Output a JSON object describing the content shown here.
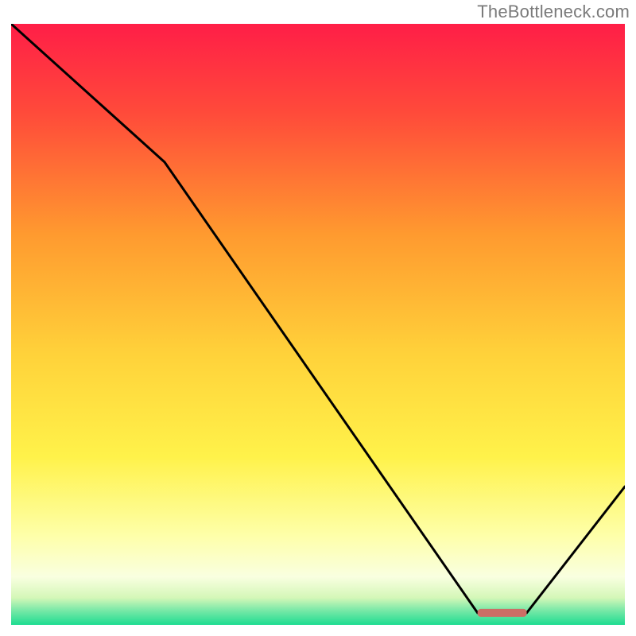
{
  "attribution": "TheBottleneck.com",
  "chart_data": {
    "type": "line",
    "title": "",
    "xlabel": "",
    "ylabel": "",
    "xlim": [
      0,
      100
    ],
    "ylim": [
      0,
      100
    ],
    "grid": false,
    "series": [
      {
        "name": "curve",
        "x": [
          0,
          25,
          76,
          84,
          100
        ],
        "values": [
          100,
          77,
          2,
          2,
          23
        ]
      }
    ],
    "marker": {
      "x_start": 76,
      "x_end": 84,
      "y": 2
    },
    "gradient_stops": [
      {
        "offset": 0.0,
        "color": "#FF1E47"
      },
      {
        "offset": 0.15,
        "color": "#FF4B3A"
      },
      {
        "offset": 0.35,
        "color": "#FF9A2F"
      },
      {
        "offset": 0.55,
        "color": "#FFD23A"
      },
      {
        "offset": 0.72,
        "color": "#FFF24A"
      },
      {
        "offset": 0.85,
        "color": "#FEFFA8"
      },
      {
        "offset": 0.92,
        "color": "#F9FFE0"
      },
      {
        "offset": 0.955,
        "color": "#D4F7B8"
      },
      {
        "offset": 0.975,
        "color": "#7CE9A8"
      },
      {
        "offset": 1.0,
        "color": "#1EDC91"
      }
    ]
  }
}
